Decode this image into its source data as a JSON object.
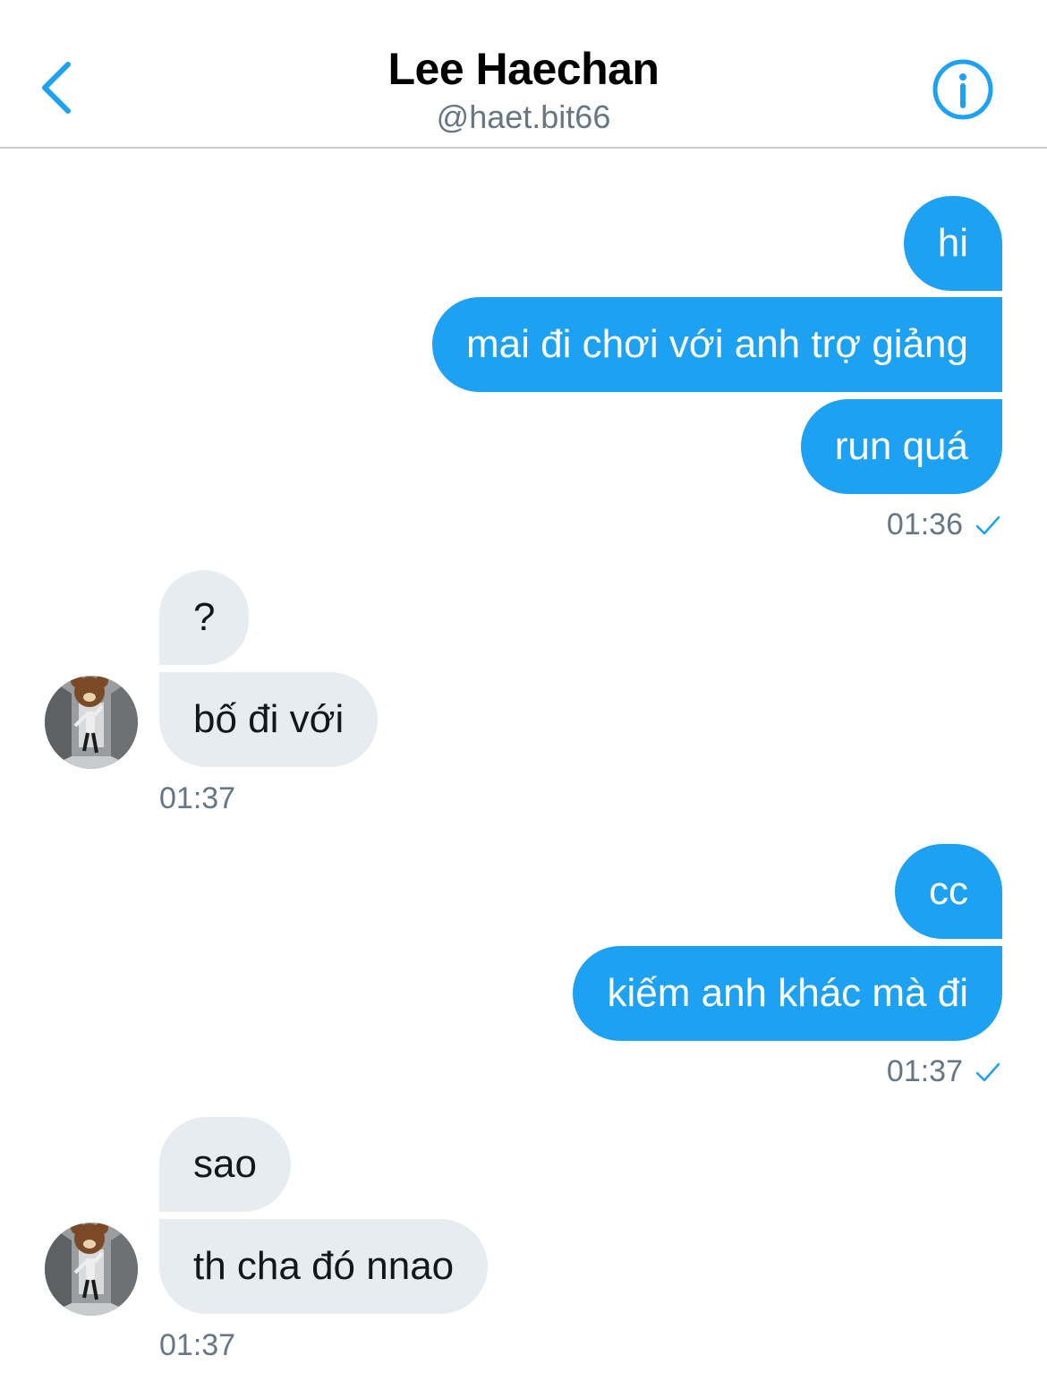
{
  "header": {
    "name": "Lee Haechan",
    "handle": "@haet.bit66"
  },
  "colors": {
    "accent": "#1da1f2",
    "incoming_bubble": "#e6ecf0",
    "timestamp": "#657786"
  },
  "icons": {
    "back": "chevron-left-icon",
    "info": "info-circle-icon",
    "read": "checkmark-icon"
  },
  "messages": [
    {
      "from": "me",
      "text": "hi"
    },
    {
      "from": "me",
      "text": "mai đi chơi với anh trợ giảng"
    },
    {
      "from": "me",
      "text": "run quá"
    },
    {
      "from": "them",
      "text": "?"
    },
    {
      "from": "them",
      "text": "bố đi với"
    },
    {
      "from": "me",
      "text": "cc"
    },
    {
      "from": "me",
      "text": "kiếm anh khác mà đi"
    },
    {
      "from": "them",
      "text": "sao"
    },
    {
      "from": "them",
      "text": "th cha đó nnao"
    }
  ],
  "timestamps": [
    "01:36",
    "01:37",
    "01:37",
    "01:37"
  ]
}
